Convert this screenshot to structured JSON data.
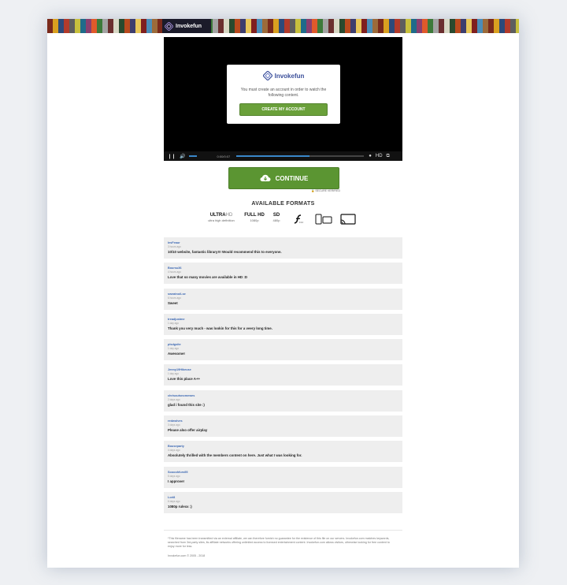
{
  "brand": {
    "name": "Invokefun"
  },
  "banner": {
    "tile_colors": [
      "#7a2a1c",
      "#d9a020",
      "#2c4a7a",
      "#b23b2b",
      "#5e5e5e",
      "#c7c03d",
      "#1f6b8a",
      "#8a3f6f",
      "#e05a2b",
      "#3d7a3a",
      "#a3a3a3",
      "#6b2f2f",
      "#d7d7c4",
      "#294a2e",
      "#b84a1e",
      "#3e3e6e",
      "#e8c65a",
      "#7f1f1f",
      "#4b8db8",
      "#9c6b3a"
    ]
  },
  "modal": {
    "message": "You must create an account in order to watch the following content.",
    "button_label": "CREATE MY ACCOUNT"
  },
  "player": {
    "time": "0:00/0:07",
    "progress": 0.57,
    "hd_label": "HD"
  },
  "cta": {
    "label": "CONTINUE",
    "secure_text": "SECURE VERIFIED"
  },
  "formats": {
    "title": "AVAILABLE FORMATS",
    "items": [
      {
        "name_bold": "ULTRA",
        "name_light": "HD",
        "sub": "ultra high definition"
      },
      {
        "name_bold": "FULL HD",
        "name_light": "",
        "sub": "1080p"
      },
      {
        "name_bold": "SD",
        "name_light": "",
        "sub": "480p"
      }
    ],
    "flash_label": "FLV"
  },
  "comments": [
    {
      "user": "lesFeaur",
      "time": "3 hours ago",
      "text": "10/10 website, fantastic library!!! Would recommend this to everyone."
    },
    {
      "user": "Boursu36",
      "time": "4 hours ago",
      "text": "Love that so many movies are available in HD :D"
    },
    {
      "user": "sweatnoiLse",
      "time": "6 hours ago",
      "text": "Sweet"
    },
    {
      "user": "treadjustme",
      "time": "1 day ago",
      "text": "Thank you very much - was lookin for this for a veery long time."
    },
    {
      "user": "plsdgsite",
      "time": "1 day ago",
      "text": "Awesome!"
    },
    {
      "user": "Jenny19Hikeuse",
      "time": "1 day ago",
      "text": "Love this place A++"
    },
    {
      "user": "chrisoutsnomewes",
      "time": "2 days ago",
      "text": "glad i found this site :)"
    },
    {
      "user": "redwolves",
      "time": "3 days ago",
      "text": "Please also offer airplay"
    },
    {
      "user": "Bouseparty",
      "time": "4 days ago",
      "text": "Absolutely thrilled with the members content on here. Just what I was looking for."
    },
    {
      "user": "Soooohfurs95",
      "time": "5 days ago",
      "text": "I approve!"
    },
    {
      "user": "Lori8",
      "time": "6 days ago",
      "text": "1080p rulexx :)"
    }
  ],
  "footer": {
    "note": "*This filename has been transmitted via an external affiliate, we can therefore furnish no guarantee for the existence of this file on our servers. Invokefun.com matches keywords, searched from 3rd-party sites, its affiliate networks offering unlimited access to licensed entertainment content. Invokefun.com allows visitors, otherwise looking for free content to enjoy more for less.",
    "copyright": "Invokefun.com © 2005 - 2018"
  }
}
